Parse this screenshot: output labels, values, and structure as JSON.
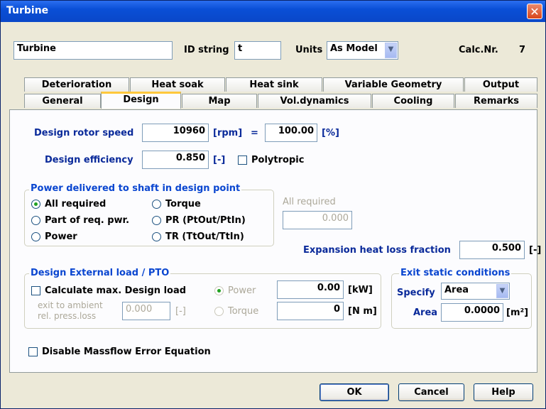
{
  "window": {
    "title": "Turbine",
    "close_icon": "✕"
  },
  "header": {
    "name_value": "Turbine",
    "id_label": "ID string",
    "id_value": "t",
    "units_label": "Units",
    "units_value": "As Model",
    "calc_label": "Calc.Nr.",
    "calc_value": "7"
  },
  "tabs": {
    "row1": [
      "Deterioration",
      "Heat soak",
      "Heat sink",
      "Variable Geometry",
      "Output"
    ],
    "row2": [
      "General",
      "Design",
      "Map",
      "Vol.dynamics",
      "Cooling",
      "Remarks"
    ],
    "active": "Design"
  },
  "design": {
    "rotor_speed_label": "Design rotor speed",
    "rotor_speed_value": "10960",
    "rotor_speed_unit": "[rpm]",
    "equals": "=",
    "rotor_speed_pct": "100.00",
    "pct_unit": "[%]",
    "efficiency_label": "Design efficiency",
    "efficiency_value": "0.850",
    "efficiency_unit": "[-]",
    "polytropic_label": "Polytropic"
  },
  "power_group": {
    "title": "Power delivered to shaft in design point",
    "options": [
      "All required",
      "Torque",
      "Part of req. pwr.",
      "PR (PtOut/PtIn)",
      "Power",
      "TR (TtOut/TtIn)"
    ],
    "selected": "All required",
    "side_label": "All required",
    "side_value": "0.000"
  },
  "expansion": {
    "label": "Expansion heat loss fraction",
    "value": "0.500",
    "unit": "[-]"
  },
  "external_load": {
    "title": "Design External load / PTO",
    "calc_max_label": "Calculate max. Design load",
    "exit_label_1": "exit to ambient",
    "exit_label_2": "rel. press.loss",
    "exit_value": "0.000",
    "exit_unit": "[-]",
    "power_label": "Power",
    "torque_label": "Torque",
    "power_value": "0.00",
    "power_unit": "[kW]",
    "torque_value": "0",
    "torque_unit": "[N m]"
  },
  "exit_static": {
    "title": "Exit static conditions",
    "specify_label": "Specify",
    "specify_value": "Area",
    "area_label": "Area",
    "area_value": "0.0000",
    "area_unit": "[m²]"
  },
  "disable_massflow_label": "Disable Massflow Error Equation",
  "buttons": {
    "ok": "OK",
    "cancel": "Cancel",
    "help": "Help"
  }
}
